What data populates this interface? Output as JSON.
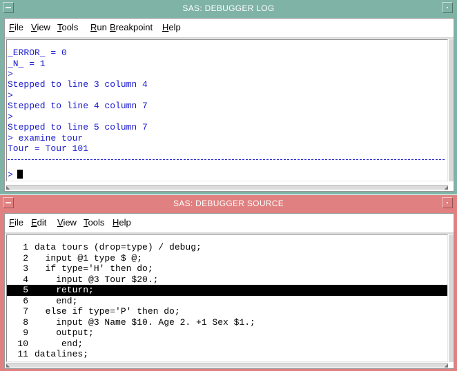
{
  "log_window": {
    "title": "SAS: DEBUGGER LOG",
    "menu": [
      {
        "pre": "",
        "key": "F",
        "post": "ile"
      },
      {
        "pre": "",
        "key": "V",
        "post": "iew"
      },
      {
        "pre": "",
        "key": "T",
        "post": "ools"
      },
      {
        "pre": "",
        "key": "R",
        "post": "un"
      },
      {
        "pre": "",
        "key": "B",
        "post": "reakpoint"
      },
      {
        "pre": "",
        "key": "H",
        "post": "elp"
      }
    ],
    "lines": [
      "_ERROR_ = 0",
      "_N_ = 1",
      ">",
      "Stepped to line 3 column 4",
      ">",
      "Stepped to line 4 column 7",
      ">",
      "Stepped to line 5 column 7",
      "> examine tour",
      "Tour = Tour 101"
    ],
    "prompt": ">"
  },
  "source_window": {
    "title": "SAS: DEBUGGER SOURCE",
    "menu": [
      {
        "pre": "",
        "key": "F",
        "post": "ile"
      },
      {
        "pre": "",
        "key": "E",
        "post": "dit"
      },
      {
        "pre": "",
        "key": "V",
        "post": "iew"
      },
      {
        "pre": "",
        "key": "T",
        "post": "ools"
      },
      {
        "pre": "",
        "key": "H",
        "post": "elp"
      }
    ],
    "current_line": 5,
    "lines": [
      {
        "num": "1",
        "code": "data tours (drop=type) / debug;"
      },
      {
        "num": "2",
        "code": "  input @1 type $ @;"
      },
      {
        "num": "3",
        "code": "  if type='H' then do;"
      },
      {
        "num": "4",
        "code": "    input @3 Tour $20.;"
      },
      {
        "num": "5",
        "code": "    return;"
      },
      {
        "num": "6",
        "code": "    end;"
      },
      {
        "num": "7",
        "code": "  else if type='P' then do;"
      },
      {
        "num": "8",
        "code": "    input @3 Name $10. Age 2. +1 Sex $1.;"
      },
      {
        "num": "9",
        "code": "    output;"
      },
      {
        "num": "10",
        "code": "     end;"
      },
      {
        "num": "11",
        "code": "datalines;"
      }
    ]
  },
  "colors": {
    "log_frame": "#7fb3a6",
    "source_frame": "#e08080",
    "log_text": "#1a1acc",
    "highlight_bg": "#000000",
    "highlight_fg": "#ffffff"
  }
}
